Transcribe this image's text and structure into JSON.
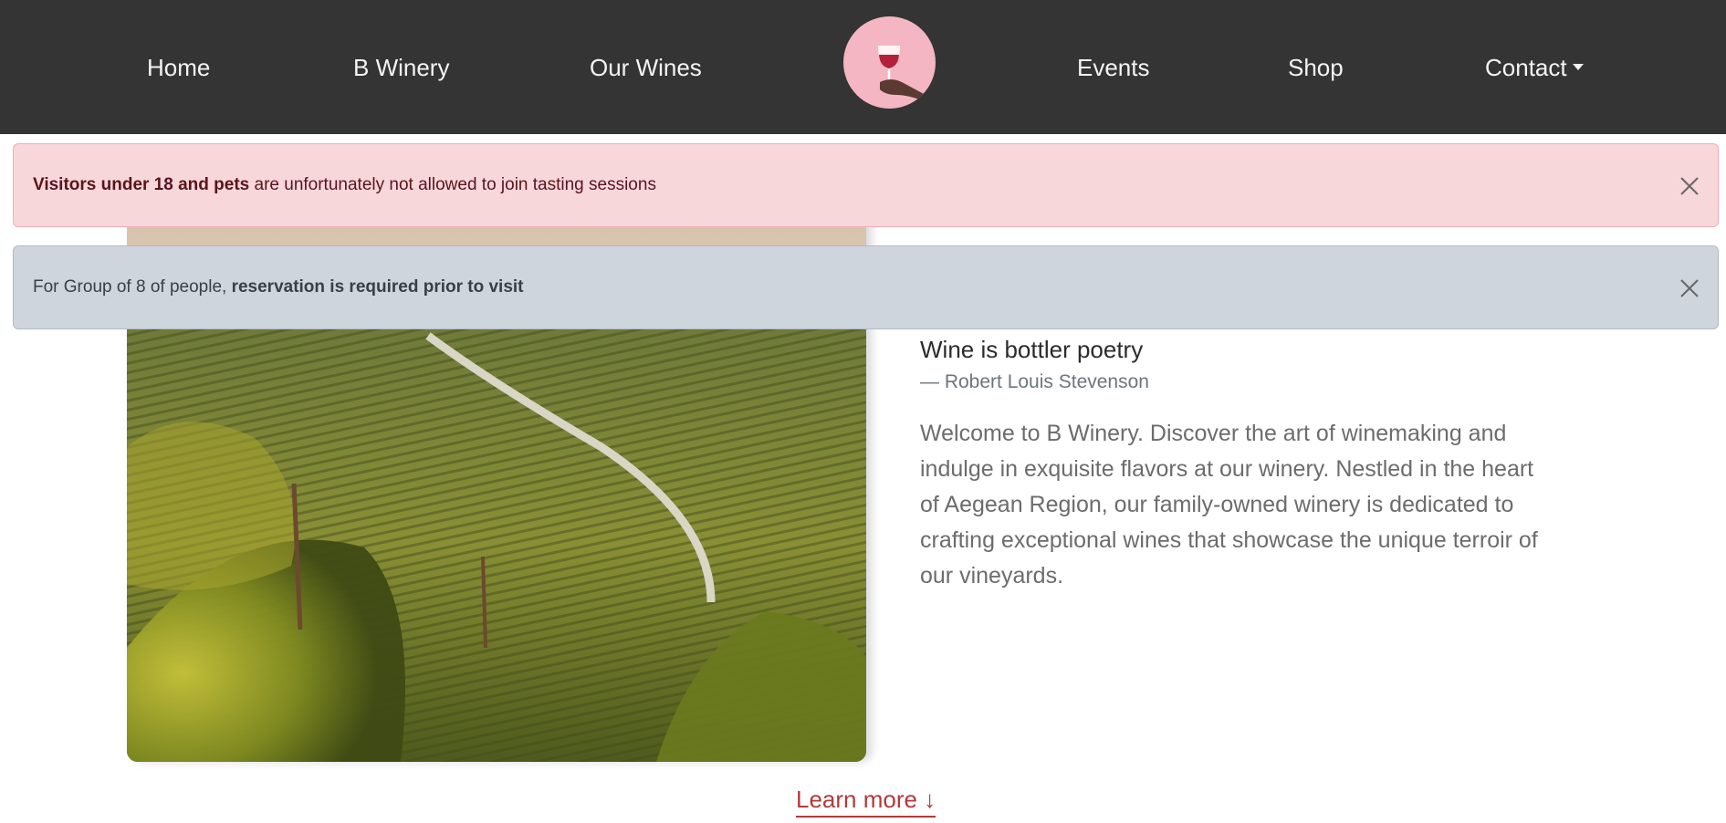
{
  "nav": {
    "items": [
      {
        "label": "Home"
      },
      {
        "label": "B Winery"
      },
      {
        "label": "Our Wines"
      },
      {
        "label": "Events"
      },
      {
        "label": "Shop"
      },
      {
        "label": "Contact"
      }
    ],
    "logo_icon": "wine-glass-in-hand-icon"
  },
  "alerts": {
    "age": {
      "bold": "Visitors under 18 and pets",
      "text": " are unfortunately not allowed to join tasting sessions"
    },
    "group": {
      "text": "For Group of 8 of people, ",
      "bold": "reservation is required prior to visit"
    }
  },
  "main": {
    "quote": "Wine is bottler poetry",
    "author": "— Robert Louis Stevenson",
    "intro": "Welcome to B Winery. Discover the art of winemaking and indulge in exquisite flavors at our winery. Nestled in the heart of Aegean Region, our family-owned winery is dedicated to crafting exceptional wines that showcase the unique terroir of our vineyards.",
    "learn_more": "Learn more ↓"
  },
  "colors": {
    "navbar": "#343434",
    "logo_bg": "#f4b6c2",
    "alert_danger_bg": "#f8d7da",
    "alert_secondary_bg": "#cfd5dd",
    "accent": "#b23a3a"
  }
}
